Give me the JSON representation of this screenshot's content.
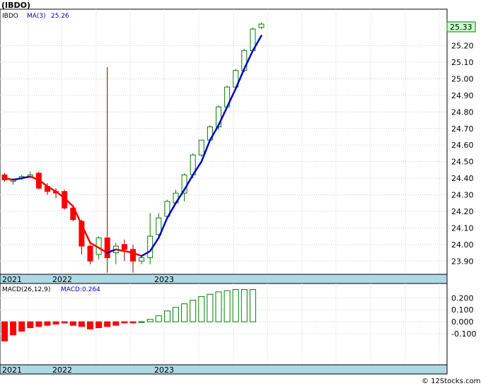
{
  "chart_data": [
    {
      "type": "candlestick",
      "title": "(IBDO)",
      "symbol_label": "IBDO",
      "ma_label": "MA(3)",
      "ma_value": "25.26",
      "last_price": "25.33",
      "ylim": [
        23.82,
        25.42
      ],
      "yticks": [
        "25.20",
        "25.10",
        "25.00",
        "24.90",
        "24.80",
        "24.70",
        "24.60",
        "24.50",
        "24.40",
        "24.30",
        "24.20",
        "24.10",
        "24.00",
        "23.90"
      ],
      "x_labels": [
        "2021",
        "2022",
        "2023"
      ],
      "grid": true,
      "colors": {
        "up": "#008000",
        "down": "#ff0000",
        "ma_up": "#0000cc",
        "ma_down": "#ff0000",
        "last_box": "#ccffcc"
      },
      "candles": [
        {
          "o": 24.42,
          "h": 24.43,
          "l": 24.38,
          "c": 24.39
        },
        {
          "o": 24.38,
          "h": 24.4,
          "l": 24.36,
          "c": 24.39
        },
        {
          "o": 24.4,
          "h": 24.42,
          "l": 24.39,
          "c": 24.41
        },
        {
          "o": 24.41,
          "h": 24.44,
          "l": 24.4,
          "c": 24.42
        },
        {
          "o": 24.43,
          "h": 24.44,
          "l": 24.33,
          "c": 24.34
        },
        {
          "o": 24.35,
          "h": 24.37,
          "l": 24.3,
          "c": 24.32
        },
        {
          "o": 24.32,
          "h": 24.34,
          "l": 24.28,
          "c": 24.31
        },
        {
          "o": 24.32,
          "h": 24.33,
          "l": 24.21,
          "c": 24.22
        },
        {
          "o": 24.22,
          "h": 24.23,
          "l": 24.14,
          "c": 24.15
        },
        {
          "o": 24.14,
          "h": 24.15,
          "l": 23.94,
          "c": 23.99
        },
        {
          "o": 23.99,
          "h": 24.0,
          "l": 23.88,
          "c": 23.9
        },
        {
          "o": 23.94,
          "h": 24.05,
          "l": 23.91,
          "c": 24.04
        },
        {
          "o": 24.04,
          "h": 25.07,
          "l": 23.83,
          "c": 23.92
        },
        {
          "o": 23.95,
          "h": 24.01,
          "l": 23.88,
          "c": 23.99
        },
        {
          "o": 24.0,
          "h": 24.03,
          "l": 23.9,
          "c": 23.97
        },
        {
          "o": 23.97,
          "h": 24.0,
          "l": 23.83,
          "c": 23.9
        },
        {
          "o": 23.9,
          "h": 23.93,
          "l": 23.88,
          "c": 23.92
        },
        {
          "o": 23.92,
          "h": 24.19,
          "l": 23.88,
          "c": 24.05
        },
        {
          "o": 24.06,
          "h": 24.19,
          "l": 24.05,
          "c": 24.16
        },
        {
          "o": 24.17,
          "h": 24.27,
          "l": 24.16,
          "c": 24.26
        },
        {
          "o": 24.25,
          "h": 24.33,
          "l": 24.24,
          "c": 24.31
        },
        {
          "o": 24.31,
          "h": 24.43,
          "l": 24.26,
          "c": 24.42
        },
        {
          "o": 24.42,
          "h": 24.55,
          "l": 24.4,
          "c": 24.54
        },
        {
          "o": 24.54,
          "h": 24.62,
          "l": 24.53,
          "c": 24.63
        },
        {
          "o": 24.63,
          "h": 24.72,
          "l": 24.62,
          "c": 24.71
        },
        {
          "o": 24.71,
          "h": 24.84,
          "l": 24.69,
          "c": 24.83
        },
        {
          "o": 24.83,
          "h": 24.96,
          "l": 24.82,
          "c": 24.95
        },
        {
          "o": 24.95,
          "h": 25.06,
          "l": 24.94,
          "c": 25.05
        },
        {
          "o": 25.05,
          "h": 25.18,
          "l": 25.04,
          "c": 25.17
        },
        {
          "o": 25.17,
          "h": 25.31,
          "l": 25.16,
          "c": 25.3
        },
        {
          "o": 25.31,
          "h": 25.34,
          "l": 25.3,
          "c": 25.33
        }
      ],
      "ma": [
        24.4,
        24.39,
        24.4,
        24.41,
        24.39,
        24.35,
        24.32,
        24.28,
        24.23,
        24.12,
        24.01,
        23.98,
        23.95,
        23.97,
        23.96,
        23.95,
        23.93,
        23.96,
        24.04,
        24.16,
        24.25,
        24.33,
        24.42,
        24.5,
        24.63,
        24.72,
        24.83,
        24.94,
        25.06,
        25.17,
        25.26
      ]
    },
    {
      "type": "bar",
      "title": "MACD(26,12,9)",
      "value_label": "MACD:0.264",
      "ylim": [
        -0.36,
        0.32
      ],
      "yticks": [
        "0.200",
        "0.100",
        "0.000",
        "-0.100"
      ],
      "x_labels": [
        "2021",
        "2022",
        "2023"
      ],
      "grid": true,
      "colors": {
        "pos": "#008000",
        "neg": "#ff0000"
      },
      "values": [
        -0.16,
        -0.11,
        -0.08,
        -0.05,
        -0.04,
        -0.03,
        -0.02,
        -0.01,
        -0.03,
        -0.04,
        -0.06,
        -0.05,
        -0.04,
        -0.03,
        -0.01,
        -0.01,
        0.0,
        0.02,
        0.05,
        0.09,
        0.12,
        0.15,
        0.18,
        0.21,
        0.23,
        0.25,
        0.26,
        0.27,
        0.27,
        0.27
      ]
    }
  ],
  "watermark": "© 12Stocks.com"
}
